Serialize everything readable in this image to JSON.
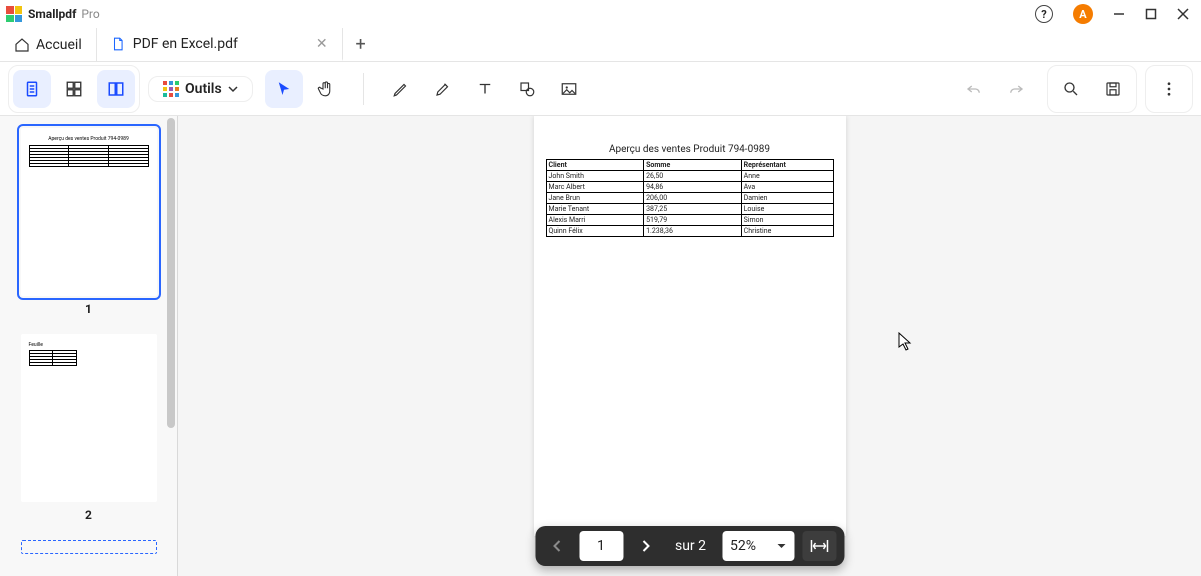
{
  "app": {
    "name": "Smallpdf",
    "edition": "Pro"
  },
  "avatar_initial": "A",
  "tabs": {
    "home": "Accueil",
    "file": "PDF en Excel.pdf"
  },
  "toolbar": {
    "outils": "Outils"
  },
  "sidebar": {
    "page1": "1",
    "page2": "2"
  },
  "pager": {
    "current": "1",
    "of_label": "sur 2",
    "zoom": "52%"
  },
  "document": {
    "title": "Aperçu des ventes Produit 794-0989",
    "headers": {
      "client": "Client",
      "somme": "Somme",
      "rep": "Représentant"
    },
    "rows": [
      {
        "client": "John Smith",
        "somme": "26,50",
        "rep": "Anne"
      },
      {
        "client": "Marc Albert",
        "somme": "94,86",
        "rep": "Ava"
      },
      {
        "client": "Jane Brun",
        "somme": "206,00",
        "rep": "Damien"
      },
      {
        "client": "Marie Tenant",
        "somme": "387,25",
        "rep": "Louise"
      },
      {
        "client": "Alexis Marri",
        "somme": "519,79",
        "rep": "Simon"
      },
      {
        "client": "Quinn Félix",
        "somme": "1.238,36",
        "rep": "Christine"
      }
    ]
  }
}
